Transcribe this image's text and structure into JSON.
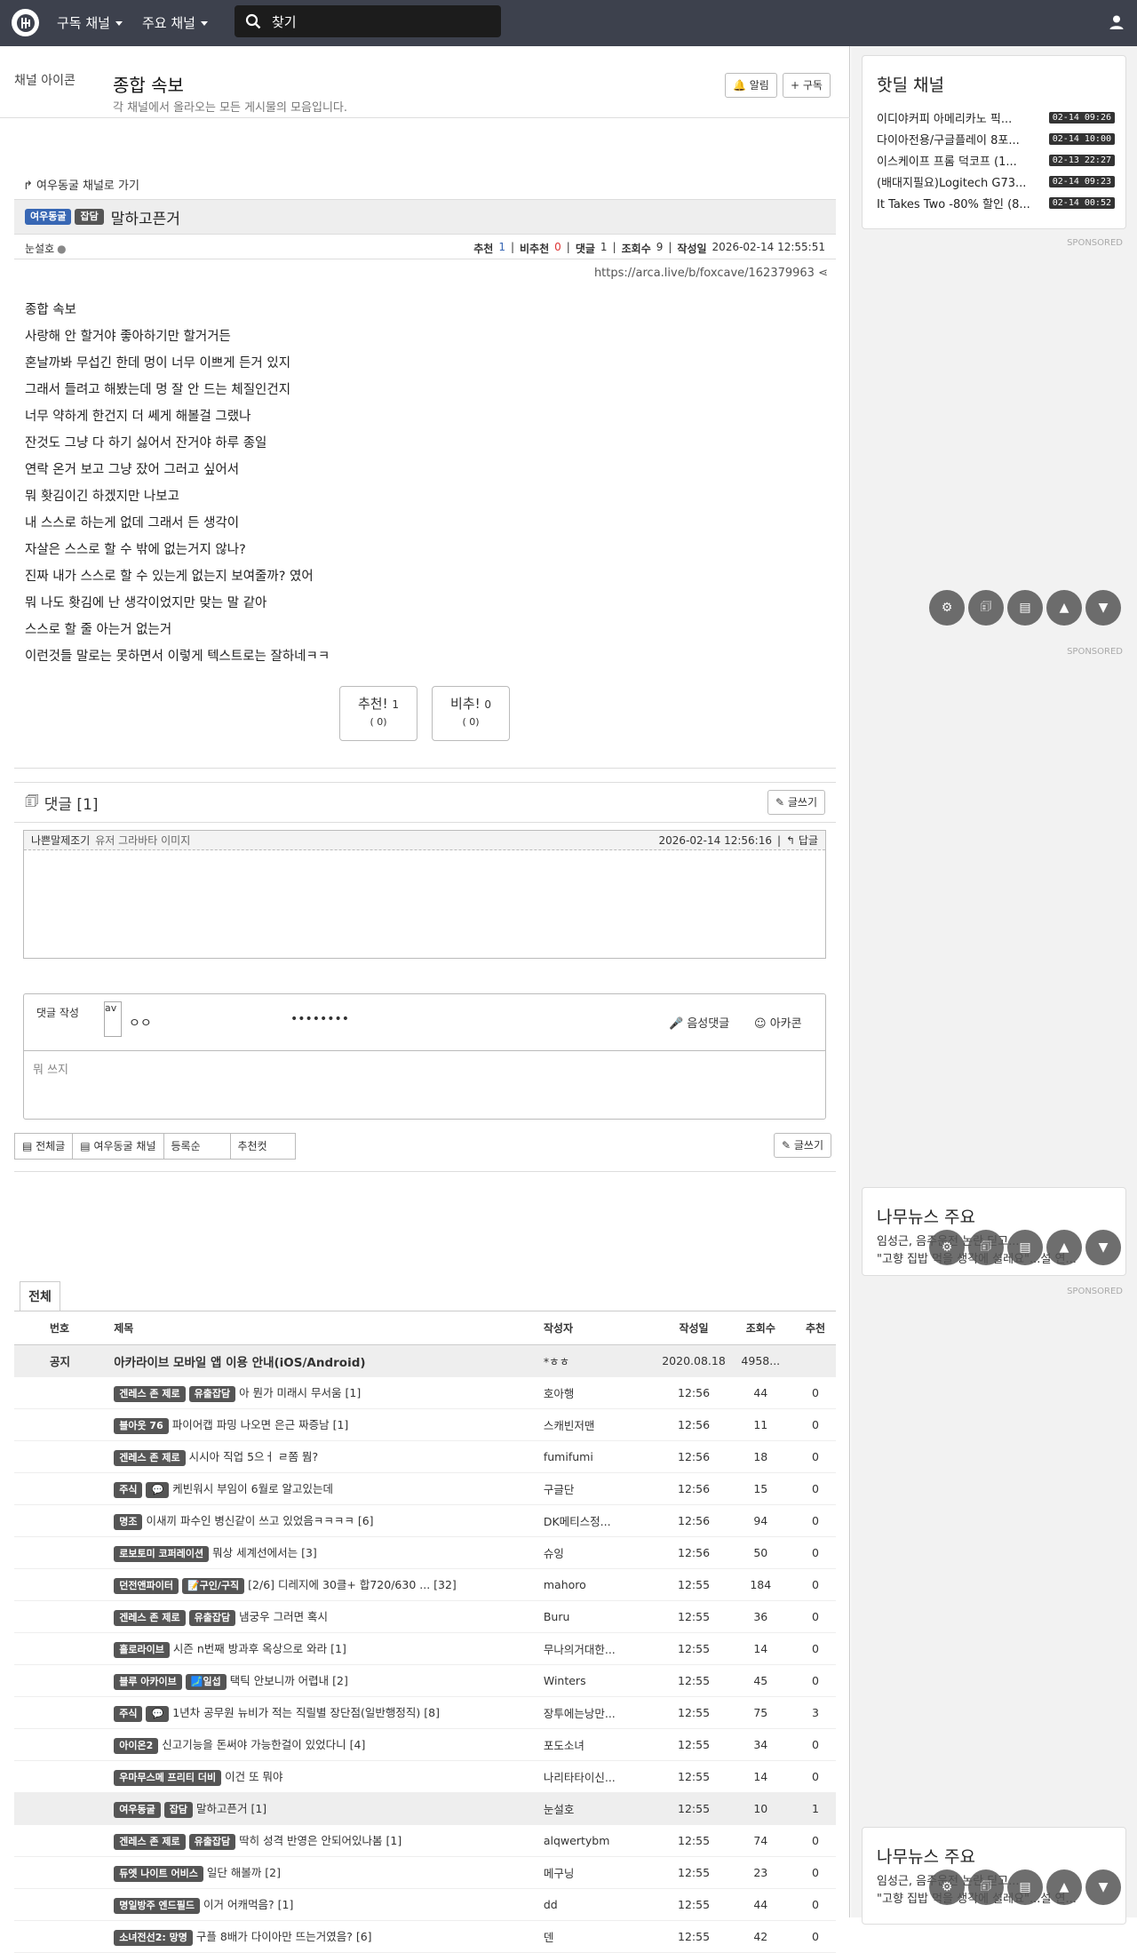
{
  "nav": {
    "menu1": "구독 채널",
    "menu2": "주요 채널",
    "search_placeholder": "찾기"
  },
  "channel": {
    "img_alt": "채널 아이콘",
    "title": "종합 속보",
    "desc": "각 채널에서 올라오는 모든 게시물의 모음입니다.",
    "alarm": "알림",
    "subscribe": "구독"
  },
  "post": {
    "back": "여우동굴 채널로 가기",
    "badge1": "여우동굴",
    "badge2": "잡담",
    "title": "말하고픈거",
    "author": "눈설호",
    "rec_label": "추천",
    "rec": "1",
    "nrec_label": "비추천",
    "nrec": "0",
    "cmt_label": "댓글",
    "cmt": "1",
    "view_label": "조회수",
    "view": "9",
    "date_label": "작성일",
    "date": "2026-02-14 12:55:51",
    "url": "https://arca.live/b/foxcave/162379963",
    "img_alt": "종합 속보",
    "lines": [
      "사랑해 안 할거야 좋아하기만 할거거든",
      "혼날까봐 무섭긴 한데 멍이 너무 이쁘게 든거 있지",
      "그래서 들려고 해봤는데 멍 잘 안 드는 체질인건지",
      "너무 약하게 한건지 더 쎄게 해볼걸 그랬나",
      "잔것도 그냥 다 하기 싫어서 잔거야 하루 종일",
      "연락 온거 보고 그냥 잤어 그러고 싶어서",
      "뭐 홧김이긴 하겠지만 나보고",
      "내 스스로 하는게 없데 그래서 든 생각이",
      "자살은 스스로 할 수 밖에 없는거지 않나?",
      "진짜 내가 스스로 할 수 있는게 없는지 보여줄까? 였어",
      "뭐 나도 홧김에 난 생각이었지만 맞는 말 같아",
      "스스로 할 줄 아는거 없는거",
      "이런것들 말로는 못하면서 이렇게 텍스트로는 잘하네ㅋㅋ"
    ],
    "vote_up": "추천!",
    "vote_up_n": "1",
    "vote_up_sub": "( 0)",
    "vote_down": "비추!",
    "vote_down_n": "0",
    "vote_down_sub": "( 0)"
  },
  "comments": {
    "title": "댓글 [1]",
    "write": "글쓰기",
    "c1_author": "나쁜말제조기",
    "c1_img": "유저 그라바타 이미지",
    "c1_date": "2026-02-14 12:56:16",
    "c1_reply": "답글"
  },
  "write": {
    "label": "댓글 작성",
    "av": "av",
    "nick": "ㅇㅇ",
    "pw": "••••••••",
    "voice": "음성댓글",
    "arcacon": "아카콘",
    "placeholder": "뭐 쓰지"
  },
  "listbtns": {
    "all": "전체글",
    "ch": "여우동굴 채널",
    "order": "등록순",
    "best": "추천컷",
    "write": "글쓰기"
  },
  "list": {
    "tab": "전체",
    "h_no": "번호",
    "h_title": "제목",
    "h_author": "작성자",
    "h_date": "작성일",
    "h_view": "조회수",
    "h_rec": "추천",
    "rows": [
      {
        "no": "공지",
        "b": [],
        "t": "아카라이브 모바일 앱 이용 안내(iOS/Android)",
        "a": "*ㅎㅎ",
        "d": "2020.08.18",
        "v": "4958...",
        "r": "",
        "notice": true
      },
      {
        "no": "",
        "b": [
          "겐레스 존 제로",
          "유출잡담"
        ],
        "t": "아 뭔가 미래시 무서움 [1]",
        "a": "호아행",
        "d": "12:56",
        "v": "44",
        "r": "0"
      },
      {
        "no": "",
        "b": [
          "블아웃 76"
        ],
        "t": "파이어캡 파밍 나오면 은근 짜증남 [1]",
        "a": "스캐빈저맨",
        "d": "12:56",
        "v": "11",
        "r": "0"
      },
      {
        "no": "",
        "b": [
          "겐레스 존 제로"
        ],
        "t": "시시아 직업 5으ㅓ ㄹ쫌 뭠?",
        "a": "fumifumi",
        "d": "12:56",
        "v": "18",
        "r": "0"
      },
      {
        "no": "",
        "b": [
          "주식",
          "💬"
        ],
        "t": "케빈워시 부임이 6월로 알고있는데",
        "a": "구글단",
        "d": "12:56",
        "v": "15",
        "r": "0"
      },
      {
        "no": "",
        "b": [
          "명조"
        ],
        "t": "이새끼 파수인 병신같이 쓰고 있었음ㅋㅋㅋㅋ [6]",
        "a": "DK메티스정...",
        "d": "12:56",
        "v": "94",
        "r": "0"
      },
      {
        "no": "",
        "b": [
          "로보토미 코퍼레이션"
        ],
        "t": "뭐상 세계선에서는 [3]",
        "a": "슈잉",
        "d": "12:56",
        "v": "50",
        "r": "0"
      },
      {
        "no": "",
        "b": [
          "던전앤파이터",
          "📝구인/구직"
        ],
        "t": "[2/6] 디레지에 30클+ 합720/630 ... [32]",
        "a": "mahoro",
        "d": "12:55",
        "v": "184",
        "r": "0"
      },
      {
        "no": "",
        "b": [
          "겐레스 존 제로",
          "유출잡담"
        ],
        "t": "냄궁우 그러면 혹시",
        "a": "Buru",
        "d": "12:55",
        "v": "36",
        "r": "0"
      },
      {
        "no": "",
        "b": [
          "홀로라이브"
        ],
        "t": "시즌 n번째 방과후 옥상으로 와라 [1]",
        "a": "무나의거대한...",
        "d": "12:55",
        "v": "14",
        "r": "0"
      },
      {
        "no": "",
        "b": [
          "블루 아카이브",
          "🗾일섭"
        ],
        "t": "택틱 안보니까 어렵내 [2]",
        "a": "Winters",
        "d": "12:55",
        "v": "45",
        "r": "0"
      },
      {
        "no": "",
        "b": [
          "주식",
          "💬"
        ],
        "t": "1년차 공무원 뉴비가 적는 직릴별 장단점(일반행정직) [8]",
        "a": "장투에는낭만...",
        "d": "12:55",
        "v": "75",
        "r": "3"
      },
      {
        "no": "",
        "b": [
          "아이온2"
        ],
        "t": "신고기능을 돈써야 가능한걸이 있었다니 [4]",
        "a": "포도소녀",
        "d": "12:55",
        "v": "34",
        "r": "0"
      },
      {
        "no": "",
        "b": [
          "우마무스메 프리티 더비"
        ],
        "t": "이건 또 뭐야",
        "a": "나리타타이신...",
        "d": "12:55",
        "v": "14",
        "r": "0"
      },
      {
        "no": "",
        "b": [
          "여우동굴",
          "잡담"
        ],
        "t": "말하고픈거 [1]",
        "a": "눈설호",
        "d": "12:55",
        "v": "10",
        "r": "1",
        "cur": true
      },
      {
        "no": "",
        "b": [
          "겐레스 존 제로",
          "유출잡담"
        ],
        "t": "딱히 성격 반영은 안되어있나봄 [1]",
        "a": "alqwertybm",
        "d": "12:55",
        "v": "74",
        "r": "0"
      },
      {
        "no": "",
        "b": [
          "듀엣 나이트 어비스"
        ],
        "t": "일단 해볼까 [2]",
        "a": "메구닝",
        "d": "12:55",
        "v": "23",
        "r": "0"
      },
      {
        "no": "",
        "b": [
          "명일방주 엔드필드"
        ],
        "t": "이거 어캐먹음? [1]",
        "a": "dd",
        "d": "12:55",
        "v": "44",
        "r": "0"
      },
      {
        "no": "",
        "b": [
          "소녀전선2: 망명"
        ],
        "t": "구플 8배가 다이아만 뜨는거였음? [6]",
        "a": "덴",
        "d": "12:55",
        "v": "42",
        "r": "0"
      }
    ]
  },
  "side": {
    "hotdeal_title": "핫딜 채널",
    "hotdeals": [
      {
        "t": "이디야커피 아메리카노 픽...",
        "d": "02-14 09:26"
      },
      {
        "t": "다이아전용/구글플레이 8포...",
        "d": "02-14 10:00"
      },
      {
        "t": "이스케이프 프롬 덕코프 (1...",
        "d": "02-13 22:27"
      },
      {
        "t": "(배대지필요)Logitech G73...",
        "d": "02-14 09:23"
      },
      {
        "t": "It Takes Two -80% 할인 (8...",
        "d": "02-14 00:52"
      }
    ],
    "sponsored": "SPONSORED",
    "news_title": "나무뉴스 주요",
    "news1": "임성근, 음주운전 논란 딛고...",
    "news2": "\"고향 집밥 먹을 생각에 설레요\"...설 연..."
  }
}
